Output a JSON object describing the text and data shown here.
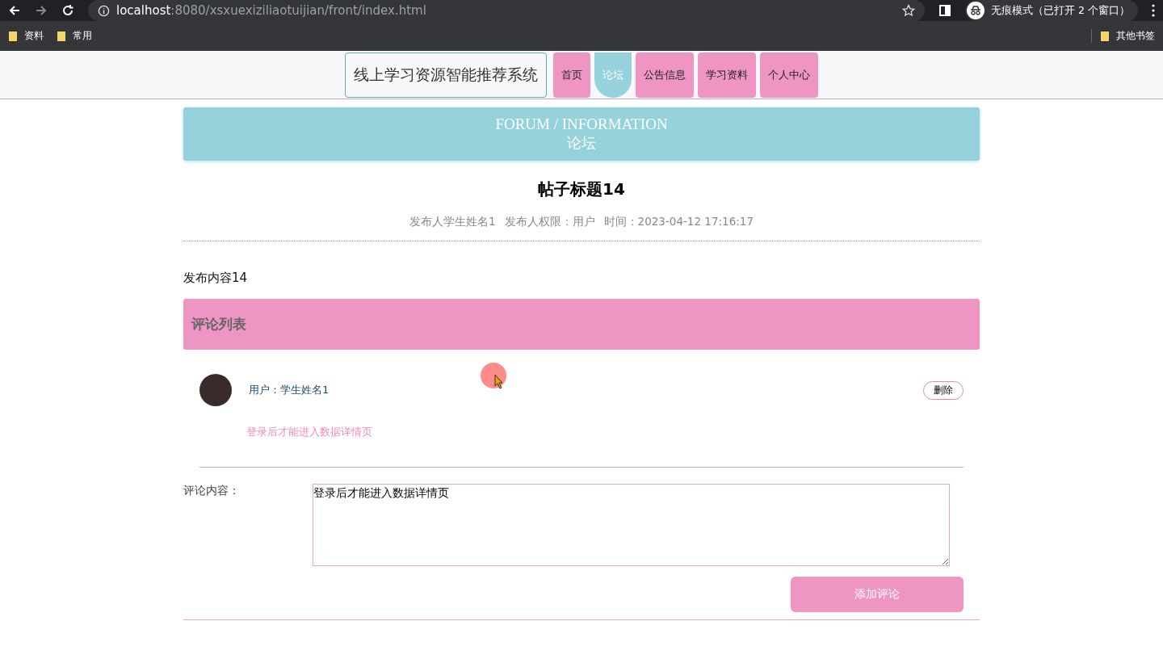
{
  "browser": {
    "url_host": "localhost",
    "url_path": ":8080/xsxuexiziliaotuijian/front/index.html",
    "incognito_label": "无痕模式（已打开 2 个窗口）",
    "bookmarks": [
      "资料",
      "常用"
    ],
    "other_bookmarks": "其他书签"
  },
  "site_title": "线上学习资源智能推荐系统",
  "nav": [
    {
      "label": "首页",
      "selected": false
    },
    {
      "label": "论坛",
      "selected": true
    },
    {
      "label": "公告信息",
      "selected": false
    },
    {
      "label": "学习资料",
      "selected": false
    },
    {
      "label": "个人中心",
      "selected": false
    }
  ],
  "banner": {
    "english": "FORUM / INFORMATION",
    "chinese": "论坛"
  },
  "post": {
    "title": "帖子标题14",
    "author": "发布人学生姓名1",
    "role": "发布人权限：用户",
    "time": "时间：2023-04-12 17:16:17",
    "content": "发布内容14"
  },
  "comments_heading": "评论列表",
  "comments": [
    {
      "user": "用户：学生姓名1",
      "delete_label": "删除",
      "text": "登录后才能进入数据详情页"
    }
  ],
  "form": {
    "label": "评论内容：",
    "value": "登录后才能进入数据详情页",
    "submit": "添加评论"
  }
}
